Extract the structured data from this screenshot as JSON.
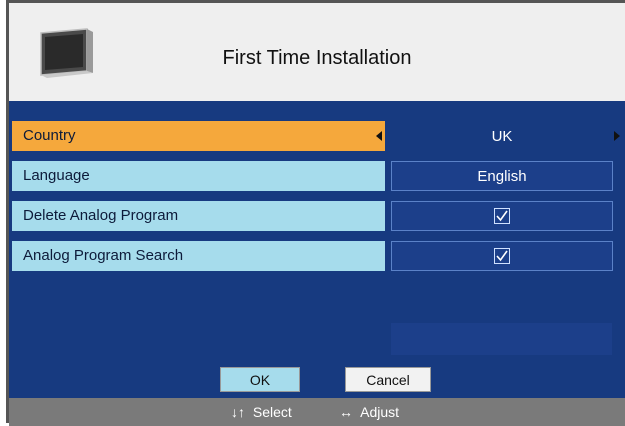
{
  "header": {
    "title": "First Time Installation",
    "icon": "tv-icon"
  },
  "rows": [
    {
      "label": "Country",
      "value": "UK",
      "selected": true
    },
    {
      "label": "Language",
      "value": "English",
      "selected": false
    },
    {
      "label": "Delete Analog Program",
      "checked": true,
      "selected": false
    },
    {
      "label": "Analog Program Search",
      "checked": true,
      "selected": false
    }
  ],
  "buttons": {
    "ok": "OK",
    "cancel": "Cancel"
  },
  "footer": {
    "select_symbol": "↓↑",
    "select_label": "Select",
    "adjust_symbol": "↔",
    "adjust_label": "Adjust"
  },
  "colors": {
    "panel": "#173a80",
    "row_normal": "#a6dcec",
    "row_selected": "#f5a83c",
    "footer": "#7a7a7a"
  }
}
